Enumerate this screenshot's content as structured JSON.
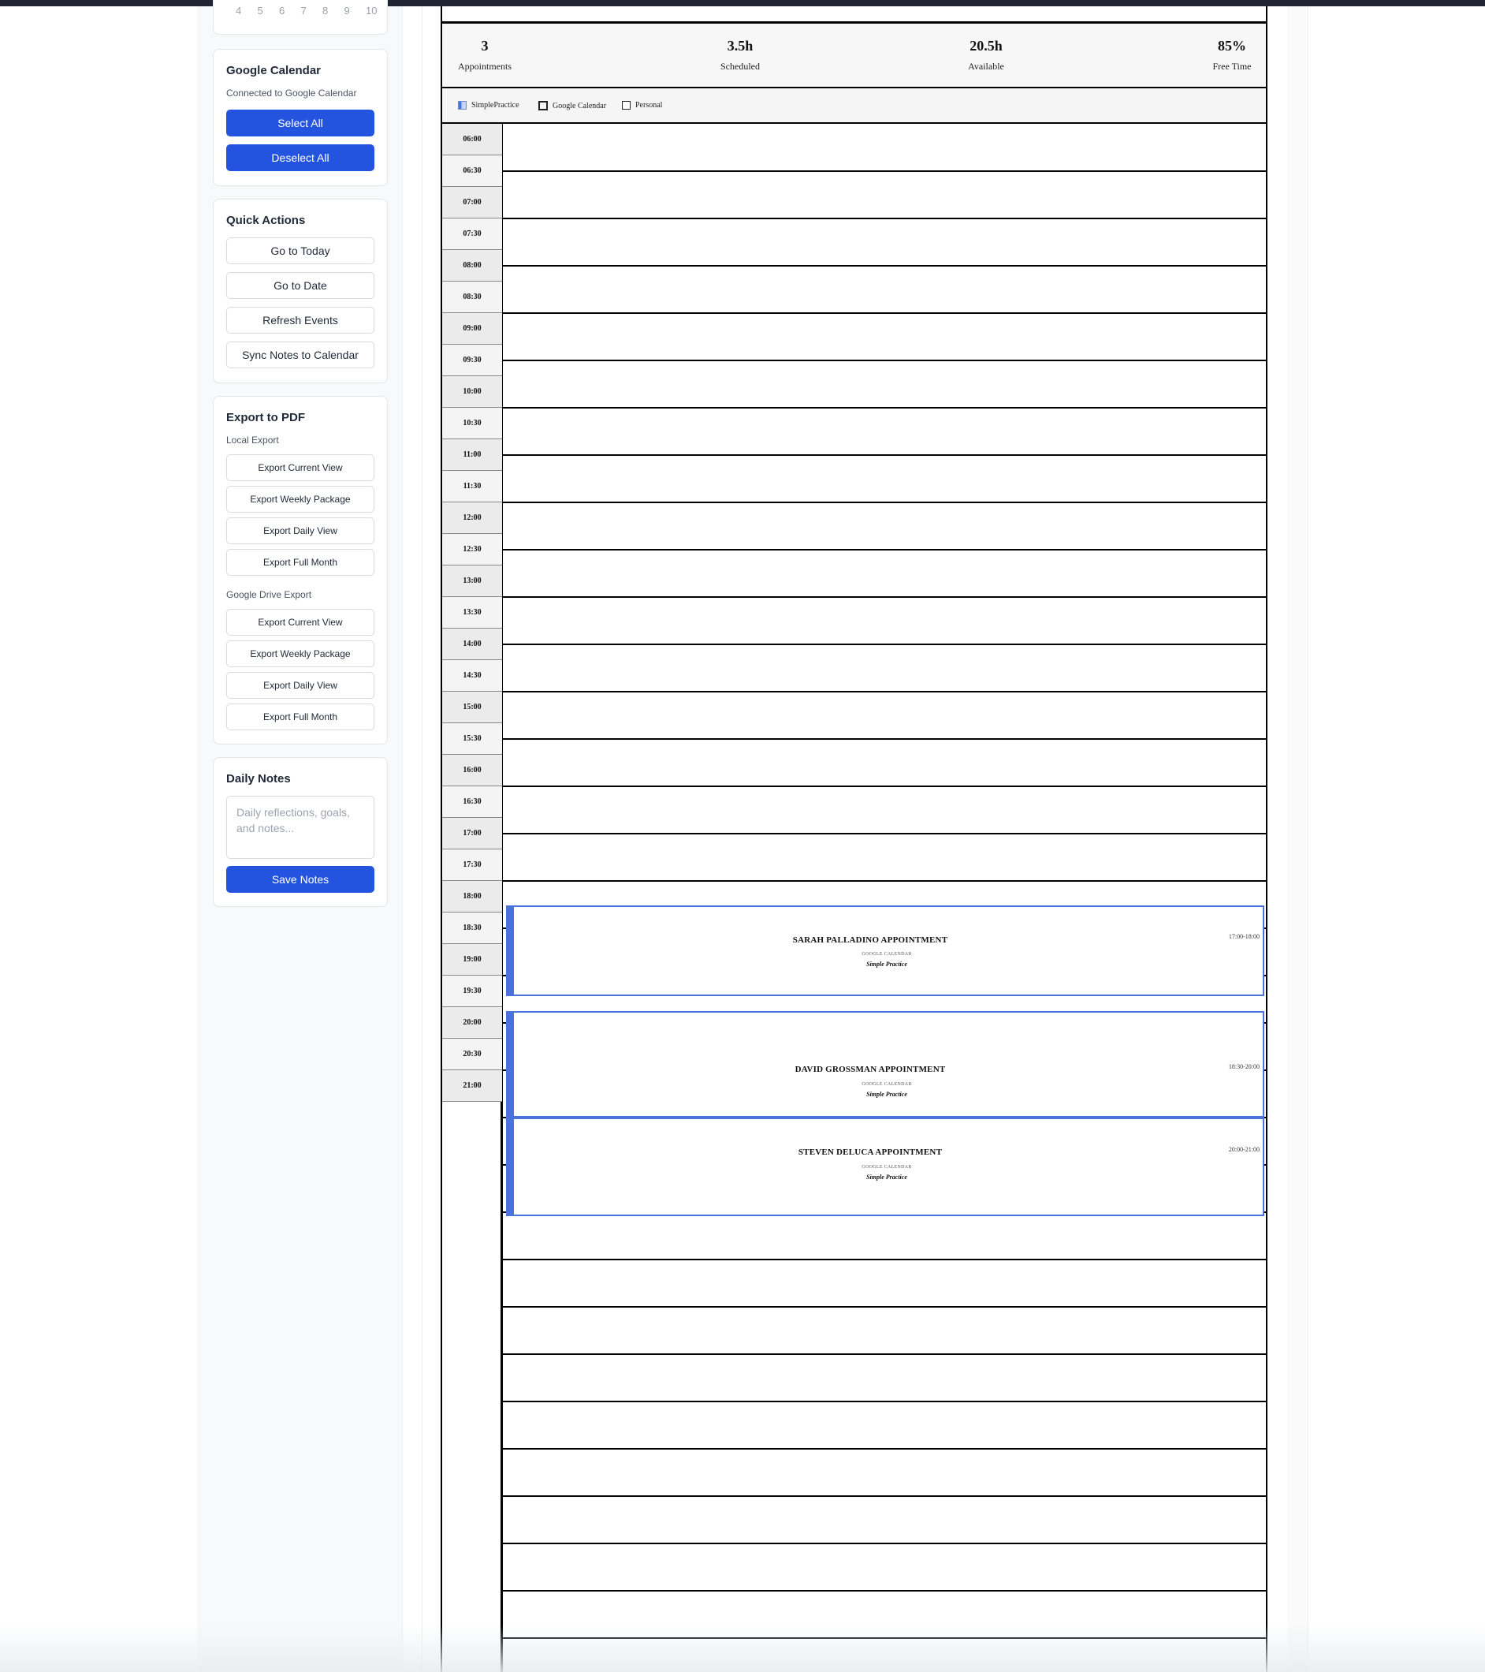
{
  "mini_calendar": {
    "days": [
      "4",
      "5",
      "6",
      "7",
      "8",
      "9",
      "10"
    ]
  },
  "google_calendar": {
    "title": "Google Calendar",
    "status": "Connected to Google Calendar",
    "select_all": "Select All",
    "deselect_all": "Deselect All"
  },
  "quick_actions": {
    "title": "Quick Actions",
    "go_today": "Go to Today",
    "go_date": "Go to Date",
    "refresh": "Refresh Events",
    "sync_notes": "Sync Notes to Calendar"
  },
  "export_pdf": {
    "title": "Export to PDF",
    "local_label": "Local Export",
    "local": [
      "Export Current View",
      "Export Weekly Package",
      "Export Daily View",
      "Export Full Month"
    ],
    "drive_label": "Google Drive Export",
    "drive": [
      "Export Current View",
      "Export Weekly Package",
      "Export Daily View",
      "Export Full Month"
    ]
  },
  "daily_notes": {
    "title": "Daily Notes",
    "placeholder": "Daily reflections, goals, and notes...",
    "save": "Save Notes"
  },
  "stats": {
    "appointments_value": "3",
    "appointments_label": "Appointments",
    "scheduled_value": "3.5h",
    "scheduled_label": "Scheduled",
    "available_value": "20.5h",
    "available_label": "Available",
    "free_value": "85%",
    "free_label": "Free Time"
  },
  "legend": {
    "simplepractice": "SimplePractice",
    "google": "Google Calendar",
    "personal": "Personal"
  },
  "time_slots": [
    "06:00",
    "06:30",
    "07:00",
    "07:30",
    "08:00",
    "08:30",
    "09:00",
    "09:30",
    "10:00",
    "10:30",
    "11:00",
    "11:30",
    "12:00",
    "12:30",
    "13:00",
    "13:30",
    "14:00",
    "14:30",
    "15:00",
    "15:30",
    "16:00",
    "16:30",
    "17:00",
    "17:30",
    "18:00",
    "18:30",
    "19:00",
    "19:30",
    "20:00",
    "20:30",
    "21:00"
  ],
  "appointments": [
    {
      "name": "SARAH PALLADINO APPOINTMENT",
      "source": "GOOGLE CALENDAR",
      "calendar": "Simple Practice",
      "time": "17:00-18:00"
    },
    {
      "name": "DAVID GROSSMAN APPOINTMENT",
      "source": "GOOGLE CALENDAR",
      "calendar": "Simple Practice",
      "time": "18:30-20:00"
    },
    {
      "name": "STEVEN DELUCA APPOINTMENT",
      "source": "GOOGLE CALENDAR",
      "calendar": "Simple Practice",
      "time": "20:00-21:00"
    }
  ]
}
